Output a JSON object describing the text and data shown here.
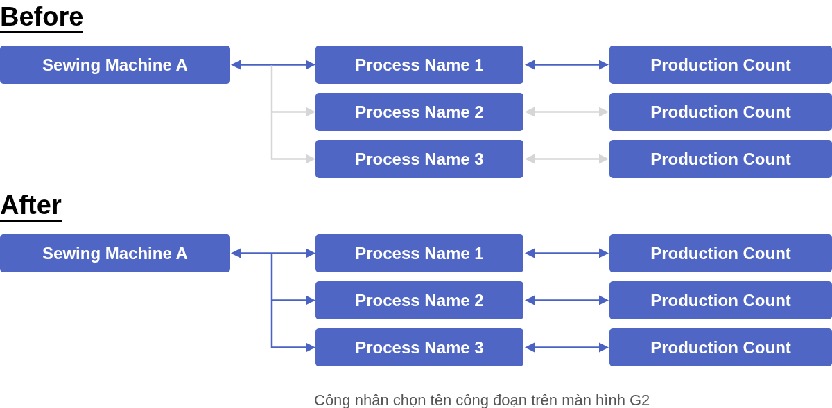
{
  "sections": [
    {
      "title": "Before",
      "source": "Sewing Machine A",
      "rows": [
        {
          "process": "Process Name 1",
          "count": "Production Count",
          "active": true
        },
        {
          "process": "Process Name 2",
          "count": "Production Count",
          "active": false
        },
        {
          "process": "Process Name 3",
          "count": "Production Count",
          "active": false
        }
      ]
    },
    {
      "title": "After",
      "source": "Sewing Machine A",
      "rows": [
        {
          "process": "Process Name 1",
          "count": "Production Count",
          "active": true
        },
        {
          "process": "Process Name 2",
          "count": "Production Count",
          "active": true
        },
        {
          "process": "Process Name 3",
          "count": "Production Count",
          "active": true
        }
      ]
    }
  ],
  "caption": "Công nhân chọn tên công đoạn trên màn hình G2"
}
